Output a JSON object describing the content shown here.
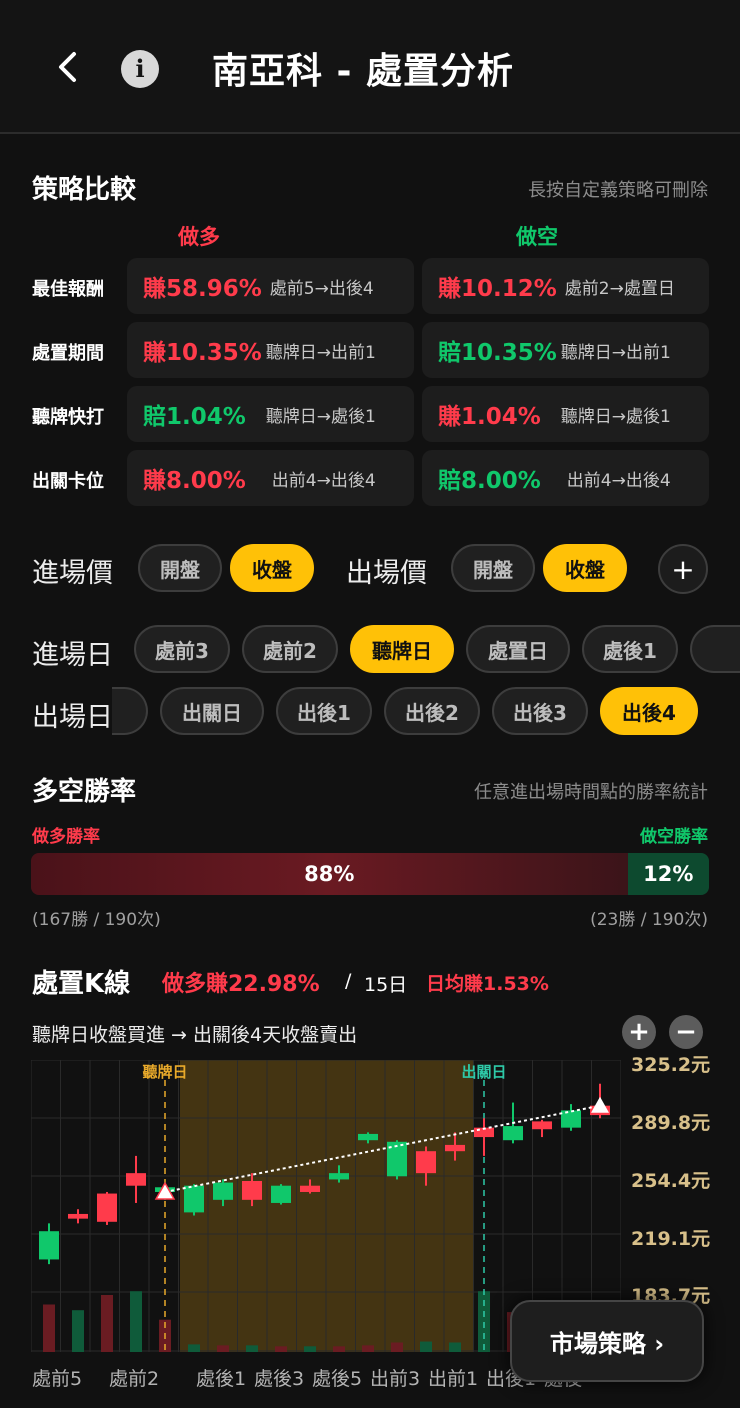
{
  "header": {
    "back_icon": "chevron-left-icon",
    "info_icon": "info-icon",
    "info_glyph": "i",
    "title": "南亞科 - 處置分析"
  },
  "strategy": {
    "title": "策略比較",
    "hint": "長按自定義策略可刪除",
    "long_label": "做多",
    "short_label": "做空",
    "rows": [
      {
        "label": "最佳報酬",
        "long": {
          "value": "賺58.96%",
          "range": "處前5→出後4",
          "color": "red"
        },
        "short": {
          "value": "賺10.12%",
          "range": "處前2→處置日",
          "color": "red"
        }
      },
      {
        "label": "處置期間",
        "long": {
          "value": "賺10.35%",
          "range": "聽牌日→出前1",
          "color": "red"
        },
        "short": {
          "value": "賠10.35%",
          "range": "聽牌日→出前1",
          "color": "green"
        }
      },
      {
        "label": "聽牌快打",
        "long": {
          "value": "賠1.04%",
          "range": "聽牌日→處後1",
          "color": "green"
        },
        "short": {
          "value": "賺1.04%",
          "range": "聽牌日→處後1",
          "color": "red"
        }
      },
      {
        "label": "出關卡位",
        "long": {
          "value": "賺8.00%",
          "range": "出前4→出後4",
          "color": "red"
        },
        "short": {
          "value": "賠8.00%",
          "range": "出前4→出後4",
          "color": "green"
        }
      }
    ]
  },
  "entry_price": {
    "label": "進場價",
    "options": [
      "開盤",
      "收盤"
    ],
    "selected": "收盤"
  },
  "exit_price": {
    "label": "出場價",
    "options": [
      "開盤",
      "收盤"
    ],
    "selected": "收盤"
  },
  "add_icon": "plus-icon",
  "add_glyph": "+",
  "entry_day": {
    "label": "進場日",
    "options": [
      "處前3",
      "處前2",
      "聽牌日",
      "處置日",
      "處後1"
    ],
    "selected": "聽牌日"
  },
  "exit_day": {
    "label": "出場日",
    "options": [
      "出關日",
      "出後1",
      "出後2",
      "出後3",
      "出後4"
    ],
    "selected": "出後4"
  },
  "winrate": {
    "title": "多空勝率",
    "hint": "任意進出場時間點的勝率統計",
    "long_label": "做多勝率",
    "short_label": "做空勝率",
    "long_pct_text": "88%",
    "short_pct_text": "12%",
    "long_pct": 88,
    "short_pct": 12,
    "long_count": "(167勝 / 190次)",
    "short_count": "(23勝 / 190次)"
  },
  "kline": {
    "title": "處置K線",
    "result": "做多賺22.98%",
    "sep": "/",
    "days": "15日",
    "daily": "日均賺1.53%",
    "desc": "聽牌日收盤買進 → 出關後4天收盤賣出",
    "zoom_in": "+",
    "zoom_out": "−",
    "marker_entry": "聽牌日",
    "marker_exit": "出關日",
    "price_labels": [
      "325.2元",
      "289.8元",
      "254.4元",
      "219.1元",
      "183.7元"
    ],
    "x_labels": [
      "處前5",
      "處前2",
      "處後1",
      "處後3",
      "處後5",
      "出前3",
      "出前1",
      "出後1",
      "處後"
    ]
  },
  "market_button": "市場策略 ›",
  "colors": {
    "up": "#ff3b4b",
    "down": "#10c86b",
    "accent": "#ffc107",
    "background": "#111111"
  },
  "chart_data": {
    "type": "candlestick",
    "y_unit": "元",
    "ylim": [
      183.7,
      325.2
    ],
    "candles": [
      {
        "open": 225,
        "close": 207,
        "high": 230,
        "low": 204
      },
      {
        "open": 233,
        "close": 236,
        "high": 239,
        "low": 230
      },
      {
        "open": 231,
        "close": 249,
        "high": 250,
        "low": 229
      },
      {
        "open": 254,
        "close": 262,
        "high": 273,
        "low": 243
      },
      {
        "open": 253,
        "close": 250,
        "high": 256,
        "low": 245
      },
      {
        "open": 254,
        "close": 237,
        "high": 255,
        "low": 235
      },
      {
        "open": 256,
        "close": 245,
        "high": 258,
        "low": 241
      },
      {
        "open": 245,
        "close": 257,
        "high": 262,
        "low": 241
      },
      {
        "open": 254,
        "close": 243,
        "high": 255,
        "low": 242
      },
      {
        "open": 250,
        "close": 254,
        "high": 258,
        "low": 249
      },
      {
        "open": 262,
        "close": 258,
        "high": 267,
        "low": 256
      },
      {
        "open": 287,
        "close": 283,
        "high": 288,
        "low": 281
      },
      {
        "open": 282,
        "close": 260,
        "high": 283,
        "low": 258
      },
      {
        "open": 262,
        "close": 276,
        "high": 279,
        "low": 254
      },
      {
        "open": 276,
        "close": 280,
        "high": 288,
        "low": 270
      },
      {
        "open": 285,
        "close": 291,
        "high": 297,
        "low": 273
      },
      {
        "open": 292,
        "close": 283,
        "high": 307,
        "low": 281
      },
      {
        "open": 290,
        "close": 295,
        "high": 296,
        "low": 285
      },
      {
        "open": 302,
        "close": 291,
        "high": 306,
        "low": 289
      },
      {
        "open": 299,
        "close": 305,
        "high": 319,
        "low": 297
      }
    ],
    "volume_colors": [
      "up",
      "down",
      "up",
      "down",
      "up",
      "down",
      "up",
      "down",
      "up",
      "down",
      "up",
      "up",
      "up",
      "down",
      "down",
      "down",
      "up",
      "down",
      "up",
      "down"
    ],
    "volume_levels": [
      0.5,
      0.44,
      0.6,
      0.64,
      0.34,
      0.08,
      0.07,
      0.07,
      0.06,
      0.06,
      0.06,
      0.07,
      0.1,
      0.11,
      0.1,
      0.64,
      0.42,
      0.34,
      0.3,
      0.3
    ],
    "entry_index": 4,
    "exit_index": 15,
    "entry_price": 250,
    "exit_price": 305
  }
}
